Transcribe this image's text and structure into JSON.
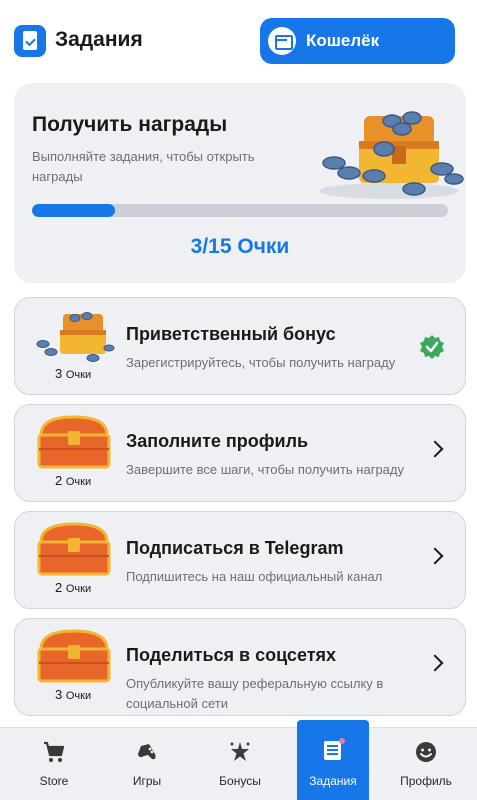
{
  "header": {
    "title": "Задания",
    "wallet_label": "Кошелёк"
  },
  "rewards": {
    "title": "Получить награды",
    "description": "Выполняйте задания, чтобы открыть награды",
    "progress": 0.2,
    "points_text": "3/15 Очки"
  },
  "tasks": [
    {
      "title": "Приветственный бонус",
      "description": "Зарегистрируйтесь, чтобы получить награду",
      "points": "3",
      "unit": "Очки",
      "status": "completed"
    },
    {
      "title": "Заполните профиль",
      "description": "Завершите все шаги, чтобы получить награду",
      "points": "2",
      "unit": "Очки",
      "status": "open"
    },
    {
      "title": "Подписаться в Telegram",
      "description": "Подпишитесь на наш официальный канал",
      "points": "2",
      "unit": "Очки",
      "status": "open"
    },
    {
      "title": "Поделиться в соцсетях",
      "description": "Опубликуйте вашу реферальную ссылку в социальной сети",
      "points": "3",
      "unit": "Очки",
      "status": "open"
    }
  ],
  "nav": [
    {
      "label": "Store",
      "icon": "cart-icon"
    },
    {
      "label": "Игры",
      "icon": "gamepad-icon"
    },
    {
      "label": "Бонусы",
      "icon": "sparkle-icon"
    },
    {
      "label": "Задания",
      "icon": "tasks-icon",
      "active": true
    },
    {
      "label": "Профиль",
      "icon": "smile-icon"
    }
  ],
  "colors": {
    "accent": "#1877e8",
    "card_bg": "#eef0f4",
    "check_green": "#3ea85a",
    "chest_orange": "#e8662a",
    "chest_gold": "#f2b632"
  }
}
